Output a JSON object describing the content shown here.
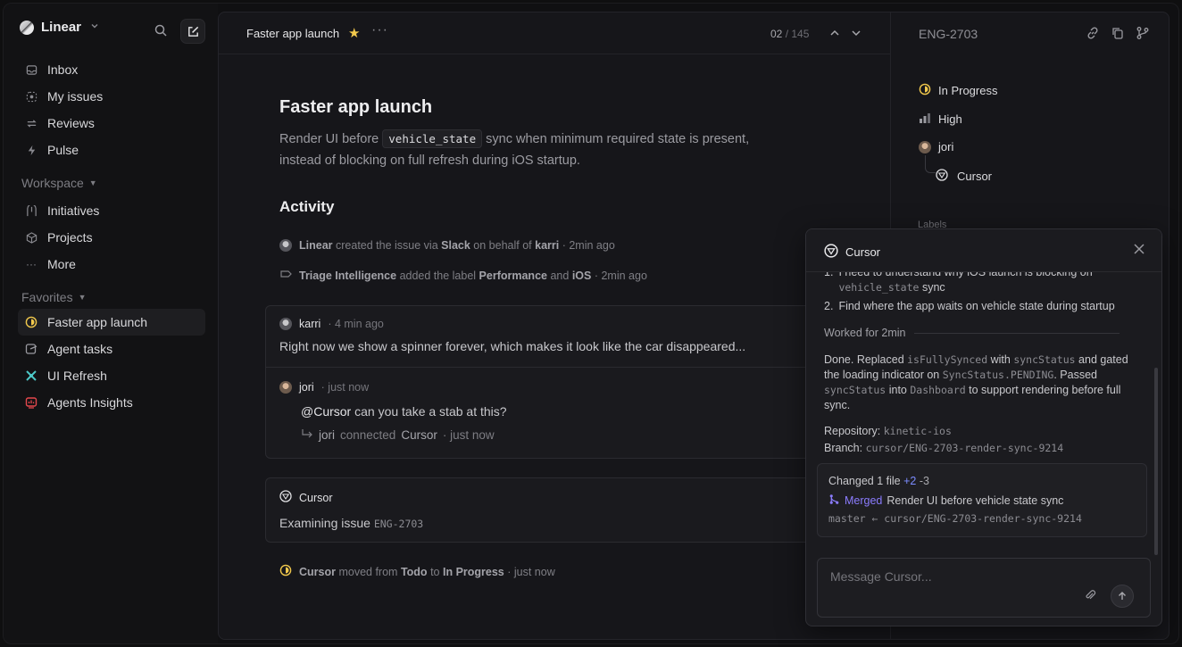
{
  "sidebar": {
    "workspace": "Linear",
    "items": [
      {
        "label": "Inbox",
        "icon": "inbox-icon"
      },
      {
        "label": "My issues",
        "icon": "my-issues-icon"
      },
      {
        "label": "Reviews",
        "icon": "reviews-icon"
      },
      {
        "label": "Pulse",
        "icon": "pulse-icon"
      }
    ],
    "workspace_section": "Workspace",
    "workspace_items": [
      {
        "label": "Initiatives",
        "icon": "initiatives-icon"
      },
      {
        "label": "Projects",
        "icon": "projects-icon"
      },
      {
        "label": "More",
        "icon": "more-icon"
      }
    ],
    "favorites_section": "Favorites",
    "favorites": [
      {
        "label": "Faster app launch",
        "icon": "in-progress-icon",
        "color": "#f2c94c"
      },
      {
        "label": "Agent tasks",
        "icon": "agent-tasks-icon",
        "color": "#9a9aa0"
      },
      {
        "label": "UI Refresh",
        "icon": "ui-refresh-icon",
        "color": "#4cc7c7"
      },
      {
        "label": "Agents Insights",
        "icon": "insights-icon",
        "color": "#e5484d"
      }
    ]
  },
  "topbar": {
    "title": "Faster app launch",
    "count_current": "02",
    "count_total": "/ 145"
  },
  "issue": {
    "title": "Faster app launch",
    "desc_before": "Render UI before ",
    "desc_code": "vehicle_state",
    "desc_after": " sync when minimum required state is present, instead of blocking on full refresh during iOS startup.",
    "activity_heading": "Activity",
    "events": [
      {
        "actor": "Linear",
        "t1": "created the issue via",
        "b1": "Slack",
        "t2": "on behalf of",
        "b2": "karri",
        "time": "· 2min ago"
      },
      {
        "actor": "Triage Intelligence",
        "t1": "added the label",
        "b1": "Performance",
        "t2": "and",
        "b2": "iOS",
        "time": "· 2min ago"
      }
    ],
    "comment": {
      "author": "karri",
      "time": "· 4 min ago",
      "text": "Right now we show a spinner forever, which makes it look like the car disappeared...",
      "reply_author": "jori",
      "reply_time": "· just now",
      "reply_mention": "@Cursor",
      "reply_text": " can you take a stab at this?",
      "sub_author": "jori",
      "sub_text": "connected",
      "sub_target": "Cursor",
      "sub_time": "· just now"
    },
    "agent_card": {
      "name": "Cursor",
      "text": "Examining issue",
      "code": "ENG-2703"
    },
    "status_event": {
      "actor": "Cursor",
      "t1": "moved from",
      "from": "Todo",
      "t2": "to",
      "to": "In Progress",
      "time": "· just now"
    }
  },
  "right_panel": {
    "issue_id": "ENG-2703",
    "status": "In Progress",
    "priority": "High",
    "assignee": "jori",
    "delegate": "Cursor",
    "labels_heading": "Labels"
  },
  "popup": {
    "title": "Cursor",
    "step1_text": "I need to understand why iOS launch is blocking on",
    "step1_code": "vehicle_state",
    "step1_after": "sync",
    "step2_text": "Find where the app waits on vehicle state during startup",
    "worked": "Worked for 2min",
    "done_p1": "Done. Replaced ",
    "done_c1": "isFullySynced",
    "done_p2": " with ",
    "done_c2": "syncStatus",
    "done_p3": " and gated the loading indicator on ",
    "done_c3": "SyncStatus.PENDING",
    "done_p4": ". Passed ",
    "done_c4": "syncStatus",
    "done_p5": " into ",
    "done_c5": "Dashboard",
    "done_p6": " to support rendering before full sync.",
    "repo_label": "Repository:",
    "repo_value": "kinetic-ios",
    "branch_label": "Branch:",
    "branch_value": "cursor/ENG-2703-render-sync-9214",
    "changed": "Changed 1 file",
    "added": "+2",
    "removed": "-3",
    "merged": "Merged",
    "pr_title": "Render UI before vehicle state sync",
    "pr_branch": "master ← cursor/ENG-2703-render-sync-9214",
    "input_placeholder": "Message Cursor..."
  }
}
